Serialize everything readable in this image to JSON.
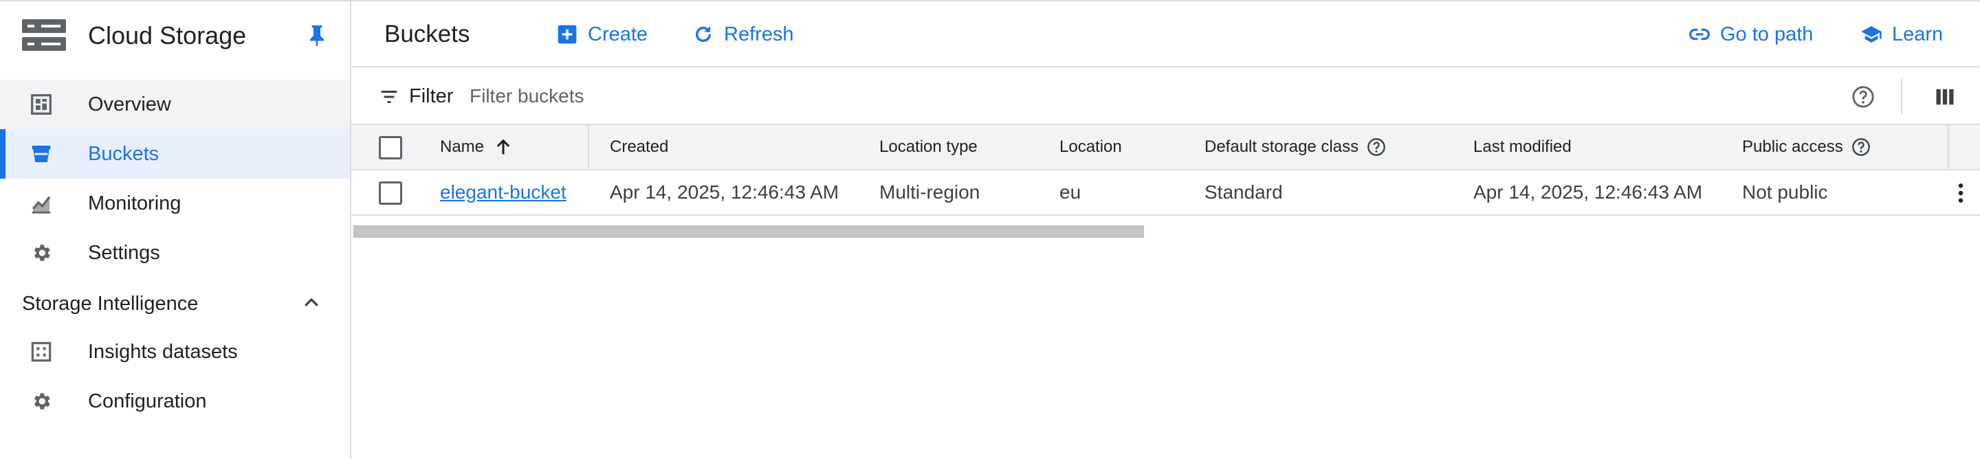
{
  "app": {
    "title": "Cloud Storage"
  },
  "sidebar": {
    "items": [
      {
        "label": "Overview",
        "icon": "dashboard-icon"
      },
      {
        "label": "Buckets",
        "icon": "bucket-icon",
        "active": true
      },
      {
        "label": "Monitoring",
        "icon": "monitoring-icon"
      },
      {
        "label": "Settings",
        "icon": "gear-icon"
      }
    ],
    "section": {
      "label": "Storage Intelligence",
      "expanded": true,
      "items": [
        {
          "label": "Insights datasets",
          "icon": "dataset-icon"
        },
        {
          "label": "Configuration",
          "icon": "gear-icon"
        }
      ]
    }
  },
  "header": {
    "page_title": "Buckets",
    "create_label": "Create",
    "refresh_label": "Refresh",
    "go_to_path_label": "Go to path",
    "learn_label": "Learn"
  },
  "filter": {
    "label": "Filter",
    "placeholder": "Filter buckets",
    "value": ""
  },
  "table": {
    "columns": [
      "Name",
      "Created",
      "Location type",
      "Location",
      "Default storage class",
      "Last modified",
      "Public access"
    ],
    "sort": {
      "column": "Name",
      "direction": "ascending"
    },
    "rows": [
      {
        "name": "elegant-bucket",
        "created": "Apr 14, 2025, 12:46:43 AM",
        "location_type": "Multi-region",
        "location": "eu",
        "storage_class": "Standard",
        "last_modified": "Apr 14, 2025, 12:46:43 AM",
        "public_access": "Not public"
      }
    ]
  },
  "colors": {
    "accent": "#1a73e8",
    "active_bg": "#e8f0fe",
    "hover_bg": "#f1f3f4",
    "border": "#dadce0",
    "text": "#202124",
    "text_secondary": "#3c4043",
    "icon_gray": "#5f6368"
  }
}
